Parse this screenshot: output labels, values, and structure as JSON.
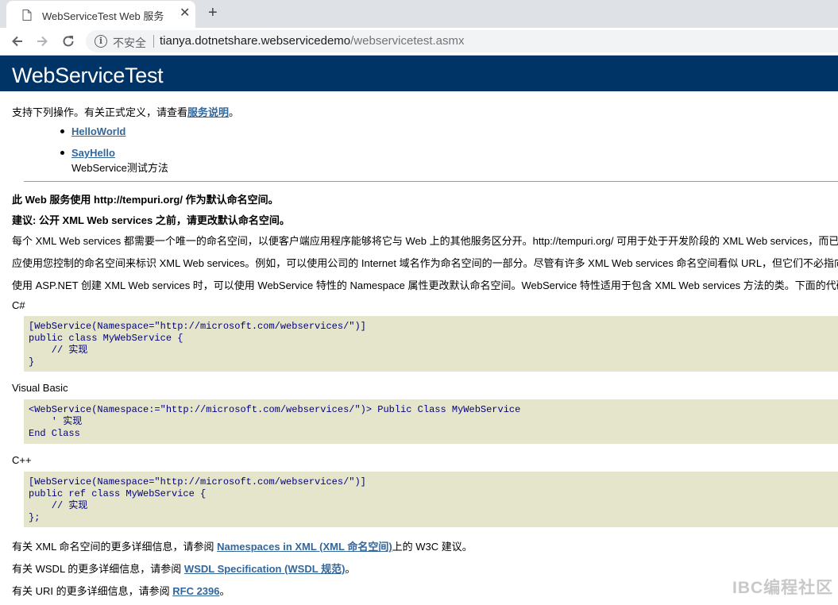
{
  "browser": {
    "tab_title": "WebServiceTest Web 服务",
    "close_glyph": "✕",
    "new_tab_glyph": "+",
    "security_label": "不安全",
    "url_host": "tianya.dotnetshare.webservicedemo",
    "url_path": "/webservicetest.asmx"
  },
  "page": {
    "title": "WebServiceTest",
    "intro_text": "支持下列操作。有关正式定义，请查看",
    "intro_link": "服务说明",
    "intro_end": "。",
    "operations": [
      {
        "name": "HelloWorld",
        "description": ""
      },
      {
        "name": "SayHello",
        "description": "WebService测试方法"
      }
    ],
    "namespace_heading": "此 Web 服务使用 http://tempuri.org/ 作为默认命名空间。",
    "recommendation_heading": "建议: 公开 XML Web services 之前，请更改默认命名空间。",
    "para1": "每个 XML Web services 都需要一个唯一的命名空间，以便客户端应用程序能够将它与 Web 上的其他服务区分开。http://tempuri.org/ 可用于处于开发阶段的 XML Web services，而已发布的",
    "para2": "应使用您控制的命名空间来标识 XML Web services。例如，可以使用公司的 Internet 域名作为命名空间的一部分。尽管有许多 XML Web services 命名空间看似 URL，但它们不必指向 Web 上",
    "para3": "使用 ASP.NET 创建 XML Web services 时，可以使用 WebService 特性的 Namespace 属性更改默认命名空间。WebService 特性适用于包含 XML Web services 方法的类。下面的代码实例",
    "examples": [
      {
        "lang": "C#",
        "code": "[WebService(Namespace=\"http://microsoft.com/webservices/\")]\npublic class MyWebService {\n    // 实现\n}"
      },
      {
        "lang": "Visual Basic",
        "code": "<WebService(Namespace:=\"http://microsoft.com/webservices/\")> Public Class MyWebService\n    ' 实现\nEnd Class"
      },
      {
        "lang": "C++",
        "code": "[WebService(Namespace=\"http://microsoft.com/webservices/\")]\npublic ref class MyWebService {\n    // 实现\n};"
      }
    ],
    "footer_xml_pre": "有关 XML 命名空间的更多详细信息，请参阅 ",
    "footer_xml_link": "Namespaces in XML (XML 命名空间)",
    "footer_xml_post": "上的 W3C 建议。",
    "footer_wsdl_pre": "有关 WSDL 的更多详细信息，请参阅 ",
    "footer_wsdl_link": "WSDL Specification (WSDL 规范)",
    "footer_wsdl_post": "。",
    "footer_uri_pre": "有关 URI 的更多详细信息，请参阅 ",
    "footer_uri_link": "RFC 2396",
    "footer_uri_post": "。",
    "watermark": "IBC编程社区"
  }
}
